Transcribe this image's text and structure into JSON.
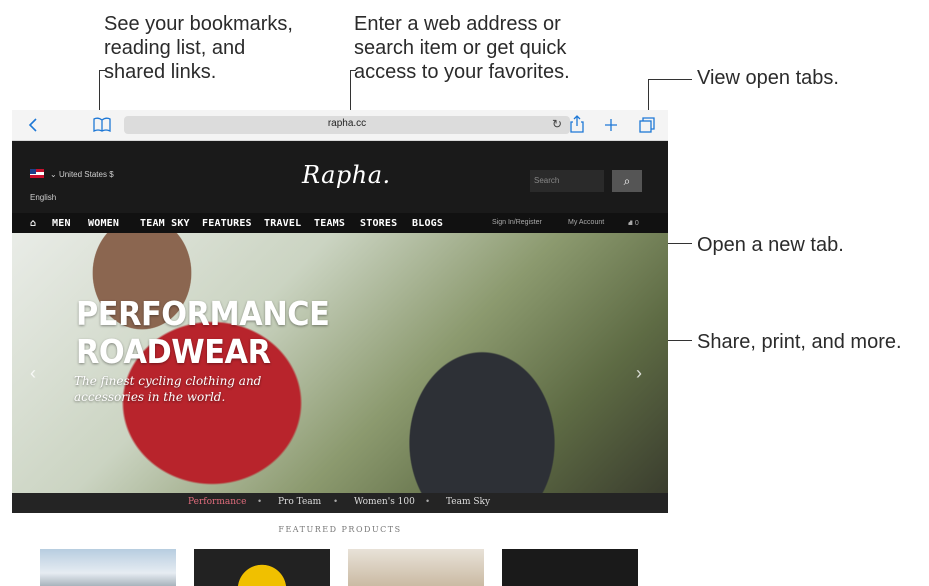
{
  "callouts": {
    "bookmarks": "See your bookmarks,\nreading list, and\nshared links.",
    "address": "Enter a web address or\nsearch item or get quick\naccess to your favorites.",
    "tabs": "View open tabs.",
    "new_tab": "Open a new tab.",
    "share": "Share, print, and more."
  },
  "toolbar": {
    "back_icon": "chevron-left-icon",
    "bookmarks_icon": "book-icon",
    "url": "rapha.cc",
    "reload_icon": "reload-icon",
    "share_icon": "share-icon",
    "new_tab_icon": "plus-icon",
    "tabs_icon": "tabs-icon"
  },
  "site": {
    "region": "United States $",
    "language": "English",
    "logo": "Rapha.",
    "search_placeholder": "Search",
    "nav": [
      "MEN",
      "WOMEN",
      "TEAM SKY",
      "FEATURES",
      "TRAVEL",
      "TEAMS",
      "STORES",
      "BLOGS"
    ],
    "sign_in": "Sign In/Register",
    "account": "My Account",
    "basket_count": "0",
    "hero_title_1": "PERFORMANCE",
    "hero_title_2": "ROADWEAR",
    "hero_subtitle": "The finest cycling clothing and accessories in the world.",
    "categories": [
      "Performance",
      "Pro Team",
      "Women's 100",
      "Team Sky"
    ],
    "featured_title": "FEATURED PRODUCTS"
  },
  "colors": {
    "accent": "#1e78d6",
    "active_category": "#e06c7c"
  }
}
